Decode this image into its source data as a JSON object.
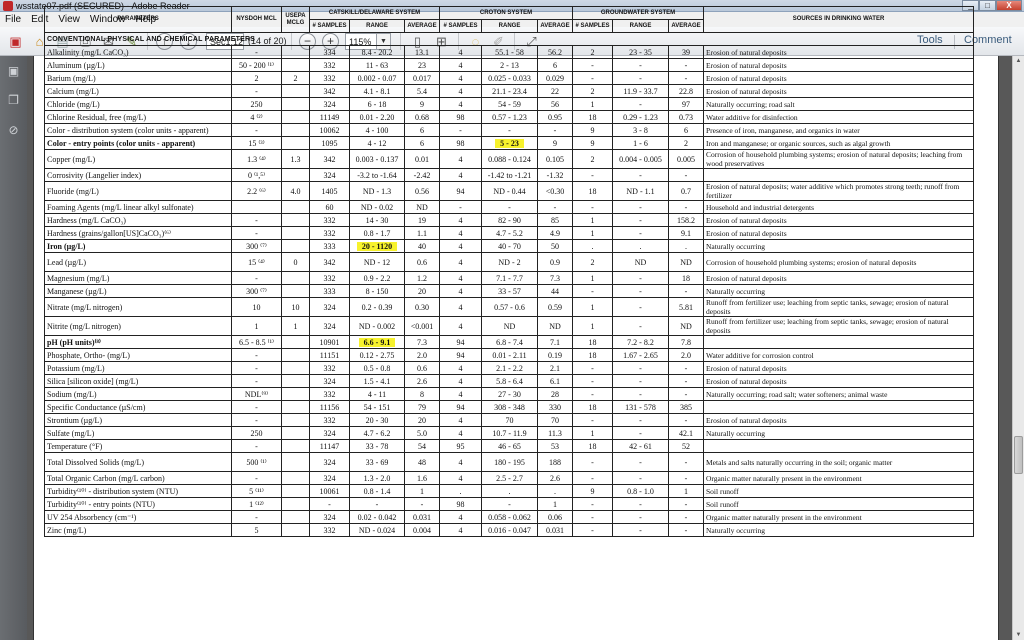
{
  "window": {
    "title": "wsstate07.pdf (SECURED) - Adobe Reader",
    "buttons": [
      "_",
      "□",
      "X"
    ]
  },
  "menu": [
    "File",
    "Edit",
    "View",
    "Window",
    "Help"
  ],
  "toolbar": {
    "page_field": "Sec1:12",
    "page_count": "(14 of 20)",
    "zoom": "115%",
    "tools_label": "Tools",
    "comment_label": "Comment"
  },
  "table": {
    "headers": {
      "parameters": "PARAMETERS",
      "nysdoh": "NYSDOH MCL",
      "usepa": "USEPA MCLG",
      "catskill": "CATSKILL/DELAWARE SYSTEM",
      "croton": "CROTON SYSTEM",
      "groundwater": "GROUNDWATER SYSTEM",
      "sources": "SOURCES IN DRINKING WATER",
      "samples": "# SAMPLES",
      "range": "RANGE",
      "average": "AVERAGE"
    },
    "section": "CONVENTIONAL PHYSICAL AND CHEMICAL PARAMETERS",
    "rows": [
      {
        "p": "Alkalinity (mg/L CaCO₃)",
        "mcl": "-",
        "mclg": "",
        "cs": "334",
        "cr": "8.4 - 20.2",
        "ca": "13.1",
        "ks": "4",
        "kr": "55.1 - 58",
        "ka": "56.2",
        "gs": "2",
        "gr": "23 - 35",
        "ga": "39",
        "src": "Erosion of natural deposits"
      },
      {
        "p": "Aluminum (µg/L)",
        "mcl": "50 - 200 ⁽¹⁾",
        "mclg": "",
        "cs": "332",
        "cr": "11 - 63",
        "ca": "23",
        "ks": "4",
        "kr": "2 - 13",
        "ka": "6",
        "gs": "-",
        "gr": "-",
        "ga": "-",
        "src": "Erosion of natural deposits"
      },
      {
        "p": "Barium (mg/L)",
        "mcl": "2",
        "mclg": "2",
        "cs": "332",
        "cr": "0.002 - 0.07",
        "ca": "0.017",
        "ks": "4",
        "kr": "0.025 - 0.033",
        "ka": "0.029",
        "gs": "-",
        "gr": "-",
        "ga": "-",
        "src": "Erosion of natural deposits"
      },
      {
        "p": "Calcium (mg/L)",
        "mcl": "-",
        "mclg": "",
        "cs": "342",
        "cr": "4.1 - 8.1",
        "ca": "5.4",
        "ks": "4",
        "kr": "21.1 - 23.4",
        "ka": "22",
        "gs": "2",
        "gr": "11.9 - 33.7",
        "ga": "22.8",
        "src": "Erosion of natural deposits"
      },
      {
        "p": "Chloride (mg/L)",
        "mcl": "250",
        "mclg": "",
        "cs": "324",
        "cr": "6 - 18",
        "ca": "9",
        "ks": "4",
        "kr": "54 - 59",
        "ka": "56",
        "gs": "1",
        "gr": "-",
        "ga": "97",
        "src": "Naturally occurring; road salt"
      },
      {
        "p": "Chlorine Residual, free (mg/L)",
        "mcl": "4 ⁽²⁾",
        "mclg": "",
        "cs": "11149",
        "cr": "0.01 - 2.20",
        "ca": "0.68",
        "ks": "98",
        "kr": "0.57 - 1.23",
        "ka": "0.95",
        "gs": "18",
        "gr": "0.29 - 1.23",
        "ga": "0.73",
        "src": "Water additive for disinfection"
      },
      {
        "p": "Color - distribution system (color units - apparent)",
        "mcl": "-",
        "mclg": "",
        "cs": "10062",
        "cr": "4 - 100",
        "ca": "6",
        "ks": "-",
        "kr": "-",
        "ka": "-",
        "gs": "9",
        "gr": "3 - 8",
        "ga": "6",
        "src": "Presence of iron, manganese, and organics in water"
      },
      {
        "p": "Color - entry points (color units - apparent)",
        "mcl": "15 ⁽³⁾",
        "mclg": "",
        "cs": "1095",
        "cr": "4 - 12",
        "ca": "6",
        "ks": "98",
        "kr": "5 - 23",
        "ka": "9",
        "gs": "9",
        "gr": "1 - 6",
        "ga": "2",
        "src": "Iron and manganese; or organic sources, such as algal growth",
        "bold": true,
        "hl": "kr"
      },
      {
        "p": "Copper (mg/L)",
        "mcl": "1.3 ⁽⁴⁾",
        "mclg": "1.3",
        "cs": "342",
        "cr": "0.003 - 0.137",
        "ca": "0.01",
        "ks": "4",
        "kr": "0.088 - 0.124",
        "ka": "0.105",
        "gs": "2",
        "gr": "0.004 - 0.005",
        "ga": "0.005",
        "src": "Corrosion of household plumbing systems; erosion of natural deposits; leaching from wood preservatives",
        "tall": true
      },
      {
        "p": "Corrosivity (Langelier index)",
        "mcl": "0 ⁽¹,⁵⁾",
        "mclg": "",
        "cs": "324",
        "cr": "-3.2 to -1.64",
        "ca": "-2.42",
        "ks": "4",
        "kr": "-1.42 to -1.21",
        "ka": "-1.32",
        "gs": "-",
        "gr": "-",
        "ga": "-",
        "src": ""
      },
      {
        "p": "Fluoride (mg/L)",
        "mcl": "2.2 ⁽⁶⁾",
        "mclg": "4.0",
        "cs": "1405",
        "cr": "ND - 1.3",
        "ca": "0.56",
        "ks": "94",
        "kr": "ND - 0.44",
        "ka": "<0.30",
        "gs": "18",
        "gr": "ND - 1.1",
        "ga": "0.7",
        "src": "Erosion of natural deposits; water additive which promotes strong teeth; runoff from fertilizer",
        "tall": true
      },
      {
        "p": "Foaming Agents (mg/L linear alkyl sulfonate)",
        "mcl": "",
        "mclg": "",
        "cs": "60",
        "cr": "ND - 0.02",
        "ca": "ND",
        "ks": "-",
        "kr": "-",
        "ka": "-",
        "gs": "-",
        "gr": "-",
        "ga": "-",
        "src": "Household and industrial detergents"
      },
      {
        "p": "Hardness (mg/L CaCO₃)",
        "mcl": "-",
        "mclg": "",
        "cs": "332",
        "cr": "14 - 30",
        "ca": "19",
        "ks": "4",
        "kr": "82 - 90",
        "ka": "85",
        "gs": "1",
        "gr": "-",
        "ga": "158.2",
        "src": "Erosion of natural deposits"
      },
      {
        "p": "Hardness (grains/gallon[US]CaCO₃)⁽⁶⁾",
        "mcl": "-",
        "mclg": "",
        "cs": "332",
        "cr": "0.8 - 1.7",
        "ca": "1.1",
        "ks": "4",
        "kr": "4.7 - 5.2",
        "ka": "4.9",
        "gs": "1",
        "gr": "-",
        "ga": "9.1",
        "src": "Erosion of natural deposits"
      },
      {
        "p": "Iron (µg/L)",
        "mcl": "300 ⁽⁷⁾",
        "mclg": "",
        "cs": "333",
        "cr": "20 - 1120",
        "ca": "40",
        "ks": "4",
        "kr": "40 - 70",
        "ka": "50",
        "gs": ".",
        "gr": ".",
        "ga": ".",
        "src": "Naturally occurring",
        "bold": true,
        "hl": "cr"
      },
      {
        "p": "Lead (µg/L)",
        "mcl": "15 ⁽⁴⁾",
        "mclg": "0",
        "cs": "342",
        "cr": "ND - 12",
        "ca": "0.6",
        "ks": "4",
        "kr": "ND - 2",
        "ka": "0.9",
        "gs": "2",
        "gr": "ND",
        "ga": "ND",
        "src": "Corrosion of household plumbing systems; erosion of natural deposits",
        "tall": true
      },
      {
        "p": "Magnesium (mg/L)",
        "mcl": "-",
        "mclg": "",
        "cs": "332",
        "cr": "0.9 - 2.2",
        "ca": "1.2",
        "ks": "4",
        "kr": "7.1 - 7.7",
        "ka": "7.3",
        "gs": "1",
        "gr": "-",
        "ga": "18",
        "src": "Erosion of natural deposits"
      },
      {
        "p": "Manganese (µg/L)",
        "mcl": "300 ⁽⁷⁾",
        "mclg": "",
        "cs": "333",
        "cr": "8 - 150",
        "ca": "20",
        "ks": "4",
        "kr": "33 - 57",
        "ka": "44",
        "gs": "-",
        "gr": "-",
        "ga": "-",
        "src": "Naturally occurring"
      },
      {
        "p": "Nitrate (mg/L nitrogen)",
        "mcl": "10",
        "mclg": "10",
        "cs": "324",
        "cr": "0.2 - 0.39",
        "ca": "0.30",
        "ks": "4",
        "kr": "0.57 - 0.6",
        "ka": "0.59",
        "gs": "1",
        "gr": "-",
        "ga": "5.81",
        "src": "Runoff from fertilizer use; leaching from septic tanks, sewage; erosion of natural deposits",
        "tall": true
      },
      {
        "p": "Nitrite (mg/L nitrogen)",
        "mcl": "1",
        "mclg": "1",
        "cs": "324",
        "cr": "ND - 0.002",
        "ca": "<0.001",
        "ks": "4",
        "kr": "ND",
        "ka": "ND",
        "gs": "1",
        "gr": "-",
        "ga": "ND",
        "src": "Runoff from fertilizer use; leaching from septic tanks, sewage; erosion of natural deposits",
        "tall": true
      },
      {
        "p": "pH (pH units)⁽⁸⁾",
        "mcl": "6.5 - 8.5 ⁽¹⁾",
        "mclg": "",
        "cs": "10901",
        "cr": "6.6 - 9.1",
        "ca": "7.3",
        "ks": "94",
        "kr": "6.8 - 7.4",
        "ka": "7.1",
        "gs": "18",
        "gr": "7.2 - 8.2",
        "ga": "7.8",
        "src": "",
        "bold": true,
        "hl": "cr"
      },
      {
        "p": "Phosphate, Ortho- (mg/L)",
        "mcl": "-",
        "mclg": "",
        "cs": "11151",
        "cr": "0.12 - 2.75",
        "ca": "2.0",
        "ks": "94",
        "kr": "0.01 - 2.11",
        "ka": "0.19",
        "gs": "18",
        "gr": "1.67 - 2.65",
        "ga": "2.0",
        "src": "Water additive for corrosion control"
      },
      {
        "p": "Potassium (mg/L)",
        "mcl": "-",
        "mclg": "",
        "cs": "332",
        "cr": "0.5 - 0.8",
        "ca": "0.6",
        "ks": "4",
        "kr": "2.1 - 2.2",
        "ka": "2.1",
        "gs": "-",
        "gr": "-",
        "ga": "-",
        "src": "Erosion of natural deposits"
      },
      {
        "p": "Silica [silicon oxide] (mg/L)",
        "mcl": "-",
        "mclg": "",
        "cs": "324",
        "cr": "1.5 - 4.1",
        "ca": "2.6",
        "ks": "4",
        "kr": "5.8 - 6.4",
        "ka": "6.1",
        "gs": "-",
        "gr": "-",
        "ga": "-",
        "src": "Erosion of natural deposits"
      },
      {
        "p": "Sodium (mg/L)",
        "mcl": "NDL⁽⁹⁾",
        "mclg": "",
        "cs": "332",
        "cr": "4 - 11",
        "ca": "8",
        "ks": "4",
        "kr": "27 - 30",
        "ka": "28",
        "gs": "-",
        "gr": "-",
        "ga": "-",
        "src": "Naturally occurring; road salt; water softeners; animal waste"
      },
      {
        "p": "Specific Conductance (µS/cm)",
        "mcl": "-",
        "mclg": "",
        "cs": "11156",
        "cr": "54 - 151",
        "ca": "79",
        "ks": "94",
        "kr": "308 - 348",
        "ka": "330",
        "gs": "18",
        "gr": "131 - 578",
        "ga": "385",
        "src": ""
      },
      {
        "p": "Strontium (µg/L)",
        "mcl": "-",
        "mclg": "",
        "cs": "332",
        "cr": "20 - 30",
        "ca": "20",
        "ks": "4",
        "kr": "70",
        "ka": "70",
        "gs": "-",
        "gr": "-",
        "ga": "-",
        "src": "Erosion of natural deposits"
      },
      {
        "p": "Sulfate (mg/L)",
        "mcl": "250",
        "mclg": "",
        "cs": "324",
        "cr": "4.7 - 6.2",
        "ca": "5.0",
        "ks": "4",
        "kr": "10.7 - 11.9",
        "ka": "11.3",
        "gs": "1",
        "gr": "-",
        "ga": "42.1",
        "src": "Naturally occurring"
      },
      {
        "p": "Temperature (°F)",
        "mcl": "-",
        "mclg": "",
        "cs": "11147",
        "cr": "33 - 78",
        "ca": "54",
        "ks": "95",
        "kr": "46 - 65",
        "ka": "53",
        "gs": "18",
        "gr": "42 - 61",
        "ga": "52",
        "src": ""
      },
      {
        "p": "Total Dissolved Solids (mg/L)",
        "mcl": "500 ⁽¹⁾",
        "mclg": "",
        "cs": "324",
        "cr": "33 - 69",
        "ca": "48",
        "ks": "4",
        "kr": "180 - 195",
        "ka": "188",
        "gs": "-",
        "gr": "-",
        "ga": "-",
        "src": "Metals and salts naturally occurring in the soil; organic matter",
        "tall": true
      },
      {
        "p": "Total Organic Carbon (mg/L carbon)",
        "mcl": "-",
        "mclg": "",
        "cs": "324",
        "cr": "1.3 - 2.0",
        "ca": "1.6",
        "ks": "4",
        "kr": "2.5 - 2.7",
        "ka": "2.6",
        "gs": "-",
        "gr": "-",
        "ga": "-",
        "src": "Organic matter naturally present in the environment"
      },
      {
        "p": "Turbidity⁽¹⁰⁾ - distribution system (NTU)",
        "mcl": "5 ⁽¹¹⁾",
        "mclg": "",
        "cs": "10061",
        "cr": "0.8 - 1.4",
        "ca": "1",
        "ks": ".",
        "kr": ".",
        "ka": ".",
        "gs": "9",
        "gr": "0.8 - 1.0",
        "ga": "1",
        "src": "Soil runoff"
      },
      {
        "p": "Turbidity⁽¹⁰⁾ - entry points (NTU)",
        "mcl": "1 ⁽¹²⁾",
        "mclg": "",
        "cs": "-",
        "cr": "-",
        "ca": "-",
        "ks": "98",
        "kr": "-",
        "ka": "1",
        "gs": "-",
        "gr": "-",
        "ga": "-",
        "src": "Soil runoff"
      },
      {
        "p": "UV 254 Absorbency (cm⁻¹)",
        "mcl": "-",
        "mclg": "",
        "cs": "324",
        "cr": "0.02 - 0.042",
        "ca": "0.031",
        "ks": "4",
        "kr": "0.058 - 0.062",
        "ka": "0.06",
        "gs": "-",
        "gr": "-",
        "ga": "-",
        "src": "Organic matter naturally present in the environment"
      },
      {
        "p": "Zinc (mg/L)",
        "mcl": "5",
        "mclg": "",
        "cs": "332",
        "cr": "ND - 0.024",
        "ca": "0.004",
        "ks": "4",
        "kr": "0.016 - 0.047",
        "ka": "0.031",
        "gs": "-",
        "gr": "-",
        "ga": "-",
        "src": "Naturally occurring"
      }
    ]
  }
}
